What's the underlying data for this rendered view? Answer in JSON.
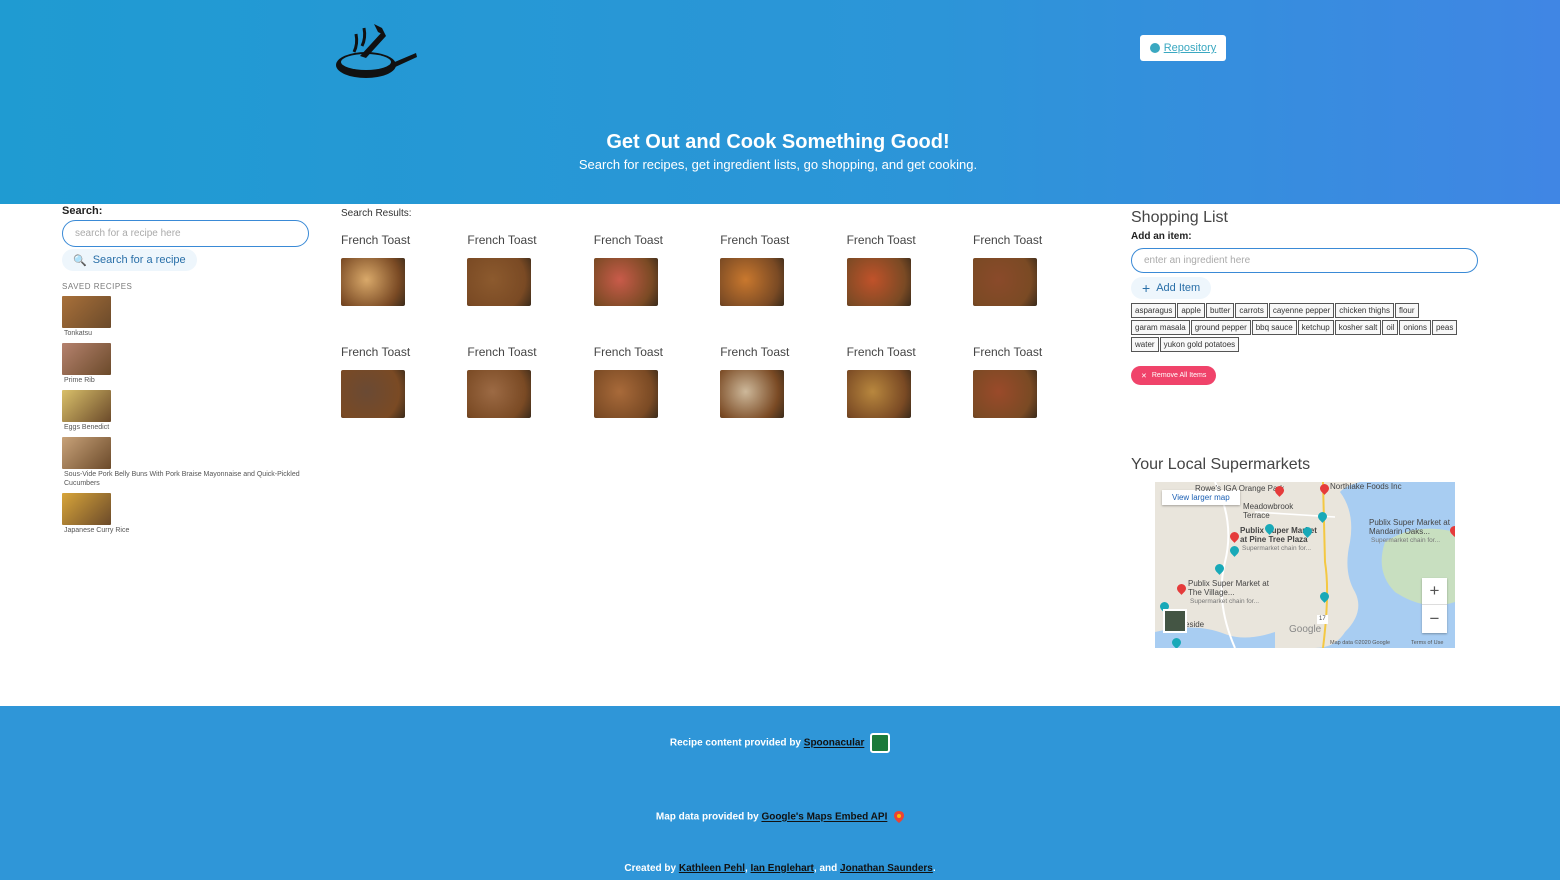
{
  "header": {
    "repo_label": "Repository",
    "title": "Get Out and Cook Something Good!",
    "subtitle": "Search for recipes, get ingredient lists, go shopping, and get cooking."
  },
  "search": {
    "label": "Search:",
    "placeholder": "search for a recipe here",
    "button_label": "Search for a recipe"
  },
  "saved": {
    "heading": "SAVED RECIPES",
    "items": [
      {
        "name": "Tonkatsu",
        "color": "#a8703a"
      },
      {
        "name": "Prime Rib",
        "color": "#b5826e"
      },
      {
        "name": "Eggs Benedict",
        "color": "#d9c06a"
      },
      {
        "name": "Sous-Vide Pork Belly Buns With Pork Braise Mayonnaise and Quick-Pickled Cucumbers",
        "color": "#c8a279"
      },
      {
        "name": "Japanese Curry Rice",
        "color": "#d8a53a"
      }
    ]
  },
  "results": {
    "label": "Search Results:",
    "items": [
      {
        "title": "French Toast",
        "color": "#d9a96a"
      },
      {
        "title": "French Toast",
        "color": "#8c5a2e"
      },
      {
        "title": "French Toast",
        "color": "#c95b4a"
      },
      {
        "title": "French Toast",
        "color": "#c9782e"
      },
      {
        "title": "French Toast",
        "color": "#c0522a"
      },
      {
        "title": "French Toast",
        "color": "#8a4a2a"
      },
      {
        "title": "French Toast",
        "color": "#6a4a34"
      },
      {
        "title": "French Toast",
        "color": "#9c6a44"
      },
      {
        "title": "French Toast",
        "color": "#a86a3a"
      },
      {
        "title": "French Toast",
        "color": "#cdb89a"
      },
      {
        "title": "French Toast",
        "color": "#b8873e"
      },
      {
        "title": "French Toast",
        "color": "#9a4a2a"
      }
    ]
  },
  "shopping": {
    "title": "Shopping List",
    "add_label": "Add an item:",
    "placeholder": "enter an ingredient here",
    "add_button": "Add Item",
    "items": [
      "asparagus",
      "apple",
      "butter",
      "carrots",
      "cayenne pepper",
      "chicken thighs",
      "flour",
      "garam masala",
      "ground pepper",
      "bbq sauce",
      "ketchup",
      "kosher salt",
      "oil",
      "onions",
      "peas",
      "water",
      "yukon gold potatoes"
    ],
    "remove_button": "Remove All Items"
  },
  "markets": {
    "title": "Your Local Supermarkets",
    "view_larger": "View larger map",
    "labels": {
      "rowes": "Rowe's IGA Orange Park",
      "northlake": "Northlake Foods Inc",
      "meadowbrook": "Meadowbrook Terrace",
      "publix_pine": "Publix Super Market at Pine Tree Plaza",
      "publix_pine_sub": "Supermarket chain for...",
      "publix_mandarin": "Publix Super Market at Mandarin Oaks...",
      "publix_mandarin_sub": "Supermarket chain for...",
      "publix_village": "Publix Super Market at The Village...",
      "publix_village_sub": "Supermarket chain for...",
      "side": "eside",
      "google": "Google",
      "map_data": "Map data ©2020 Google",
      "terms": "Terms of Use",
      "route": "17"
    }
  },
  "footer": {
    "spoon_prefix": "Recipe content provided by",
    "spoon_link": "Spoonacular",
    "maps_prefix": "Map data provided by",
    "maps_link": "Google's Maps Embed API",
    "created_prefix": "Created by",
    "author1": "Kathleen Pehl",
    "author2": "Ian Englehart",
    "and": ", and",
    "author3": "Jonathan Saunders",
    "end": "."
  }
}
